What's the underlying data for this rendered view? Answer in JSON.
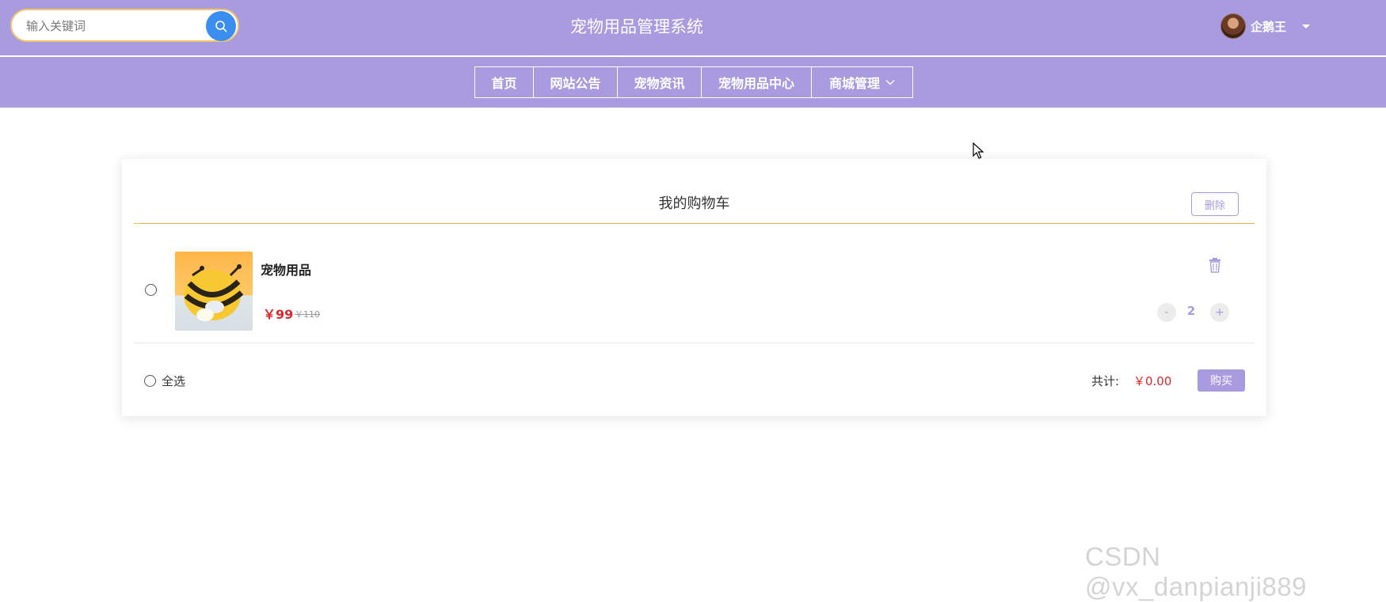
{
  "header": {
    "search_placeholder": "输入关键词",
    "site_title": "宠物用品管理系统",
    "user_name": "企鹅王"
  },
  "nav": {
    "items": [
      {
        "label": "首页"
      },
      {
        "label": "网站公告"
      },
      {
        "label": "宠物资讯"
      },
      {
        "label": "宠物用品中心"
      },
      {
        "label": "商城管理",
        "has_dropdown": true
      }
    ]
  },
  "cart": {
    "title": "我的购物车",
    "delete_label": "删除",
    "items": [
      {
        "name": "宠物用品",
        "price": "￥99",
        "original_price": "￥110",
        "quantity": "2",
        "minus": "-",
        "plus": "+"
      }
    ],
    "select_all_label": "全选",
    "total_label": "共计:",
    "total_value": "￥0.00",
    "buy_label": "购买"
  },
  "watermark": "CSDN @vx_danpianji889",
  "colors": {
    "header_bg": "#a99be0",
    "accent": "#a99be0",
    "price_red": "#e4252c",
    "search_button": "#3a8ef0",
    "divider_gold": "#e8b94a"
  }
}
